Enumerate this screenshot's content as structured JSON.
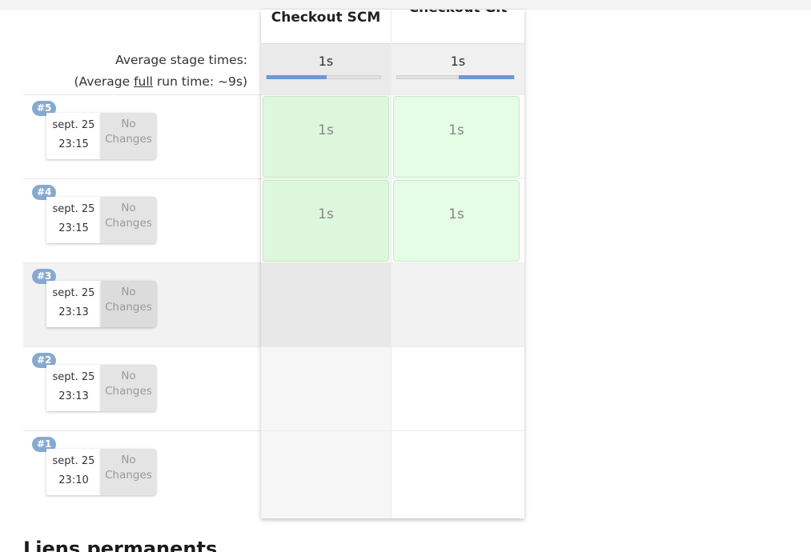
{
  "page": {
    "avg_label_line1": "Average stage times:",
    "avg_label_prefix": "(Average ",
    "avg_label_link": "full",
    "avg_label_suffix": " run time: ~9s)",
    "section_title": "Liens permanents"
  },
  "stages": [
    {
      "name": "Checkout SCM",
      "avg": "1s",
      "avg_fraction": 0.53
    },
    {
      "name": "Checkout Git",
      "avg": "1s",
      "avg_fraction": 0.47
    }
  ],
  "builds": [
    {
      "id": "#5",
      "date": "sept. 25",
      "time": "23:15",
      "changes": "No Changes",
      "cells": [
        "1s",
        "1s"
      ]
    },
    {
      "id": "#4",
      "date": "sept. 25",
      "time": "23:15",
      "changes": "No Changes",
      "cells": [
        "1s",
        "1s"
      ]
    },
    {
      "id": "#3",
      "date": "sept. 25",
      "time": "23:13",
      "changes": "No Changes",
      "cells": [
        "",
        ""
      ]
    },
    {
      "id": "#2",
      "date": "sept. 25",
      "time": "23:13",
      "changes": "No Changes",
      "cells": [
        "",
        ""
      ]
    },
    {
      "id": "#1",
      "date": "sept. 25",
      "time": "23:10",
      "changes": "No Changes",
      "cells": [
        "",
        ""
      ]
    }
  ]
}
